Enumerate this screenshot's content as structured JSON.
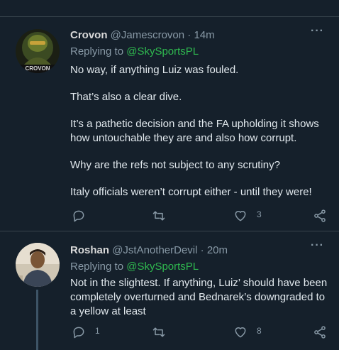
{
  "tweets": [
    {
      "name": "Crovon",
      "handle": "@Jamescrovon",
      "separator": "·",
      "time": "14m",
      "replying_prefix": "Replying to ",
      "replying_to": "@SkySportsPL",
      "avatar_text": "CROVON",
      "paragraphs": [
        "No way, if anything Luiz was fouled.",
        "That’s also a clear dive.",
        "It’s a pathetic decision and the FA upholding it shows how untouchable they are and also how corrupt.",
        "Why are the refs not subject to any scrutiny?",
        "Italy officials weren’t corrupt either - until they were!"
      ],
      "reply_count": "",
      "retweet_count": "",
      "like_count": "3"
    },
    {
      "name": "Roshan",
      "handle": "@JstAnotherDevil",
      "separator": "·",
      "time": "20m",
      "replying_prefix": "Replying to ",
      "replying_to": "@SkySportsPL",
      "paragraphs": [
        "Not in the slightest. If anything, Luiz’ should have been completely overturned and Bednarek’s downgraded to a yellow at least"
      ],
      "reply_count": "1",
      "retweet_count": "",
      "like_count": "8"
    }
  ],
  "more_label": "···",
  "colors": {
    "background": "#15202b",
    "border": "#38444d",
    "muted": "#8899a6",
    "mention": "#2fb84f"
  },
  "icons": [
    "reply-icon",
    "retweet-icon",
    "like-icon",
    "share-icon",
    "more-icon"
  ]
}
